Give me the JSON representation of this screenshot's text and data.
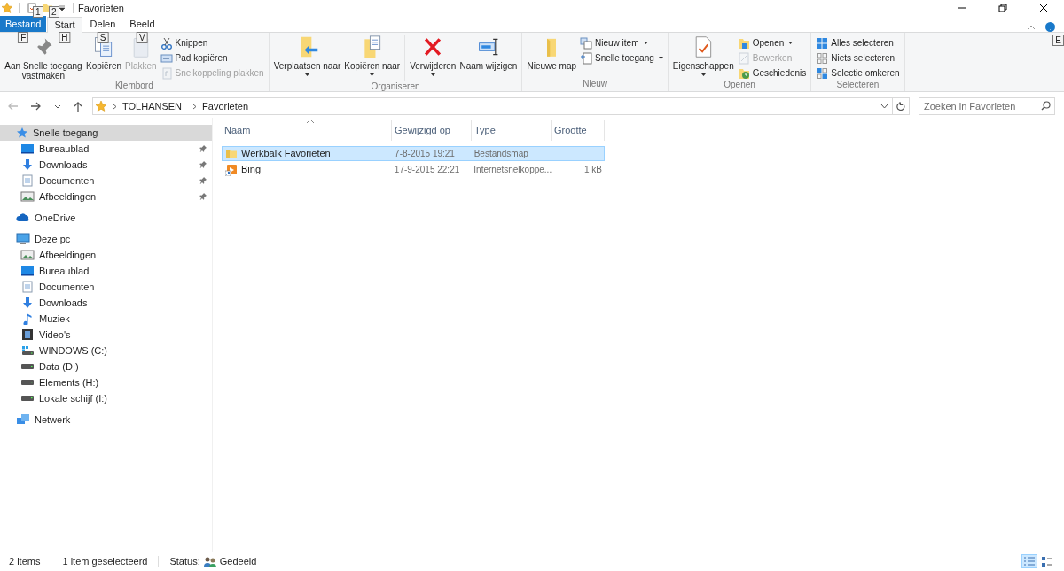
{
  "window": {
    "title": "Favorieten"
  },
  "quick_access_keytips": [
    "1",
    "2"
  ],
  "tabs": [
    {
      "label": "Bestand",
      "kind": "file",
      "keytip": "F",
      "selected": false
    },
    {
      "label": "Start",
      "kind": "normal",
      "keytip": "H",
      "selected": true
    },
    {
      "label": "Delen",
      "kind": "normal",
      "keytip": "S",
      "selected": false
    },
    {
      "label": "Beeld",
      "kind": "normal",
      "keytip": "V",
      "selected": false
    }
  ],
  "help_keytip": "E",
  "ribbon": [
    {
      "label": "Klembord",
      "items": [
        {
          "label": "Aan Snelle toegang vastmaken",
          "kind": "large",
          "disabled": false,
          "dropdown": false
        },
        {
          "label": "Kopiëren",
          "kind": "large",
          "disabled": false,
          "dropdown": false
        },
        {
          "label": "Plakken",
          "kind": "large",
          "disabled": true,
          "dropdown": false
        },
        {
          "label": "Knippen",
          "kind": "small",
          "disabled": false,
          "dropdown": false
        },
        {
          "label": "Pad kopiëren",
          "kind": "small",
          "disabled": false,
          "dropdown": false
        },
        {
          "label": "Snelkoppeling plakken",
          "kind": "small",
          "disabled": true,
          "dropdown": false
        }
      ]
    },
    {
      "label": "Organiseren",
      "items": [
        {
          "label": "Verplaatsen naar",
          "kind": "large",
          "disabled": false,
          "dropdown": true
        },
        {
          "label": "Kopiëren naar",
          "kind": "large",
          "disabled": false,
          "dropdown": true
        },
        {
          "kind": "separator"
        },
        {
          "label": "Verwijderen",
          "kind": "large",
          "disabled": false,
          "dropdown": true
        },
        {
          "label": "Naam wijzigen",
          "kind": "large",
          "disabled": false,
          "dropdown": false
        }
      ]
    },
    {
      "label": "Nieuw",
      "items": [
        {
          "label": "Nieuwe map",
          "kind": "large",
          "disabled": false,
          "dropdown": false
        },
        {
          "label": "Nieuw item",
          "kind": "small",
          "disabled": false,
          "dropdown": true
        },
        {
          "label": "Snelle toegang",
          "kind": "small",
          "disabled": false,
          "dropdown": true
        }
      ]
    },
    {
      "label": "Openen",
      "items": [
        {
          "label": "Eigenschappen",
          "kind": "large",
          "disabled": false,
          "dropdown": true
        },
        {
          "label": "Openen",
          "kind": "small",
          "disabled": false,
          "dropdown": true
        },
        {
          "label": "Bewerken",
          "kind": "small",
          "disabled": true,
          "dropdown": false
        },
        {
          "label": "Geschiedenis",
          "kind": "small",
          "disabled": false,
          "dropdown": false
        }
      ]
    },
    {
      "label": "Selecteren",
      "items": [
        {
          "label": "Alles selecteren",
          "kind": "small",
          "disabled": false,
          "dropdown": false
        },
        {
          "label": "Niets selecteren",
          "kind": "small",
          "disabled": false,
          "dropdown": false
        },
        {
          "label": "Selectie omkeren",
          "kind": "small",
          "disabled": false,
          "dropdown": false
        }
      ]
    }
  ],
  "address": {
    "path": [
      "TOLHANSEN",
      "Favorieten"
    ]
  },
  "search": {
    "placeholder": "Zoeken in Favorieten"
  },
  "navigation": [
    {
      "label": "Snelle toegang",
      "selected": true,
      "children": [
        {
          "label": "Bureaublad",
          "pinned": true,
          "selected": false
        },
        {
          "label": "Downloads",
          "pinned": true,
          "selected": false
        },
        {
          "label": "Documenten",
          "pinned": true,
          "selected": false
        },
        {
          "label": "Afbeeldingen",
          "pinned": true,
          "selected": false
        }
      ]
    },
    {
      "label": "OneDrive",
      "selected": false
    },
    {
      "label": "Deze pc",
      "selected": false,
      "children": [
        {
          "label": "Afbeeldingen",
          "pinned": false,
          "selected": false
        },
        {
          "label": "Bureaublad",
          "pinned": false,
          "selected": false
        },
        {
          "label": "Documenten",
          "pinned": false,
          "selected": false
        },
        {
          "label": "Downloads",
          "pinned": false,
          "selected": false
        },
        {
          "label": "Muziek",
          "pinned": false,
          "selected": false
        },
        {
          "label": "Video's",
          "pinned": false,
          "selected": false
        },
        {
          "label": "WINDOWS (C:)",
          "pinned": false,
          "selected": false
        },
        {
          "label": "Data (D:)",
          "pinned": false,
          "selected": false
        },
        {
          "label": "Elements (H:)",
          "pinned": false,
          "selected": false
        },
        {
          "label": "Lokale schijf (I:)",
          "pinned": false,
          "selected": false
        }
      ]
    },
    {
      "label": "Netwerk",
      "selected": false
    }
  ],
  "table": {
    "columns": [
      {
        "label": "Naam",
        "sorted": true
      },
      {
        "label": "Gewijzigd op",
        "sorted": false
      },
      {
        "label": "Type",
        "sorted": false
      },
      {
        "label": "Grootte",
        "sorted": false
      }
    ],
    "rows": [
      {
        "kind": "folder",
        "selected": true,
        "cells": [
          "Werkbalk Favorieten",
          "7-8-2015 19:21",
          "Bestandsmap",
          ""
        ]
      },
      {
        "kind": "shortcut",
        "selected": false,
        "cells": [
          "Bing",
          "17-9-2015 22:21",
          "Internetsnelkoppe...",
          "1 kB"
        ]
      }
    ]
  },
  "status_bar": {
    "count": "2 items",
    "selection": "1 item geselecteerd",
    "status_label": "Status:",
    "status": "Gedeeld"
  },
  "view_buttons": [
    {
      "kind": "details",
      "selected": true
    },
    {
      "kind": "tiles",
      "selected": false
    }
  ]
}
